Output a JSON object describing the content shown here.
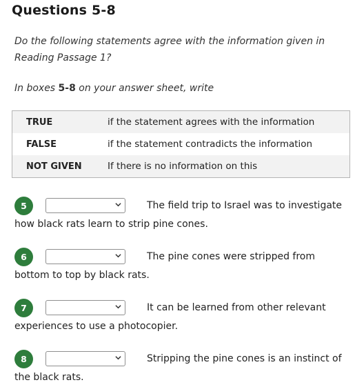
{
  "heading": "Questions 5-8",
  "instruction_line1": "Do the following statements agree with the information given in",
  "instruction_line2": "Reading Passage 1?",
  "answer_prefix": "In boxes ",
  "answer_range": "5-8",
  "answer_suffix": " on your answer sheet, write",
  "legend": [
    {
      "key": "TRUE",
      "meaning": "if the statement agrees with the information"
    },
    {
      "key": "FALSE",
      "meaning": "if the statement contradicts the information"
    },
    {
      "key": "NOT GIVEN",
      "meaning": "If there is no information on this"
    }
  ],
  "questions": [
    {
      "number": "5",
      "selected": "",
      "text_line1": "The field trip to Israel was to investigate",
      "text_line2": "how black rats learn to strip pine cones."
    },
    {
      "number": "6",
      "selected": "",
      "text_line1": "The pine cones were stripped from",
      "text_line2": "bottom to top by black rats."
    },
    {
      "number": "7",
      "selected": "",
      "text_line1": "It can be learned from other relevant",
      "text_line2": "experiences to use a photocopier."
    },
    {
      "number": "8",
      "selected": "",
      "text_line1": "Stripping the pine cones is an instinct of",
      "text_line2": "the black rats."
    }
  ],
  "colors": {
    "number_badge": "#2e7d3c",
    "table_stripe": "#f2f2f2"
  },
  "icons": {
    "dropdown": "chevron-down-icon"
  }
}
